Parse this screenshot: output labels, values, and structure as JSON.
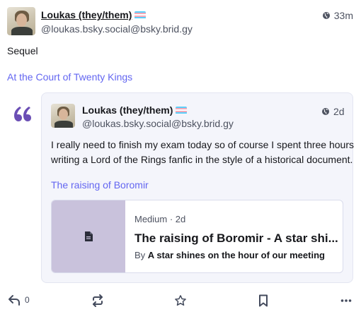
{
  "post": {
    "author_name": "Loukas (they/them)",
    "author_handle": "@loukas.bsky.social@bsky.brid.gy",
    "time": "33m",
    "body": "Sequel",
    "link_text": "At the Court of Twenty Kings"
  },
  "quote": {
    "author_name": "Loukas (they/them)",
    "author_handle": "@loukas.bsky.social@bsky.brid.gy",
    "time": "2d",
    "body_line1": "I really need to finish my exam today so of course I spent three hours",
    "body_line2": "writing a Lord of the Rings fanfic in the style of a historical document.",
    "link_text": "The raising of Boromir",
    "card": {
      "source": "Medium · 2d",
      "title": "The raising of Boromir - A star shi...",
      "by_prefix": "By",
      "by_author": "A star shines on the hour of our meeting"
    }
  },
  "actions": {
    "reply_count": "0"
  },
  "colors": {
    "accent": "#6366f1",
    "quote_mark": "#6b4fb5",
    "trans_blue": "#5bcefa",
    "trans_pink": "#f5a9b8"
  },
  "icons": [
    "globe-icon",
    "quote-icon",
    "document-icon",
    "reply-icon",
    "boost-icon",
    "star-icon",
    "bookmark-icon",
    "more-icon"
  ]
}
